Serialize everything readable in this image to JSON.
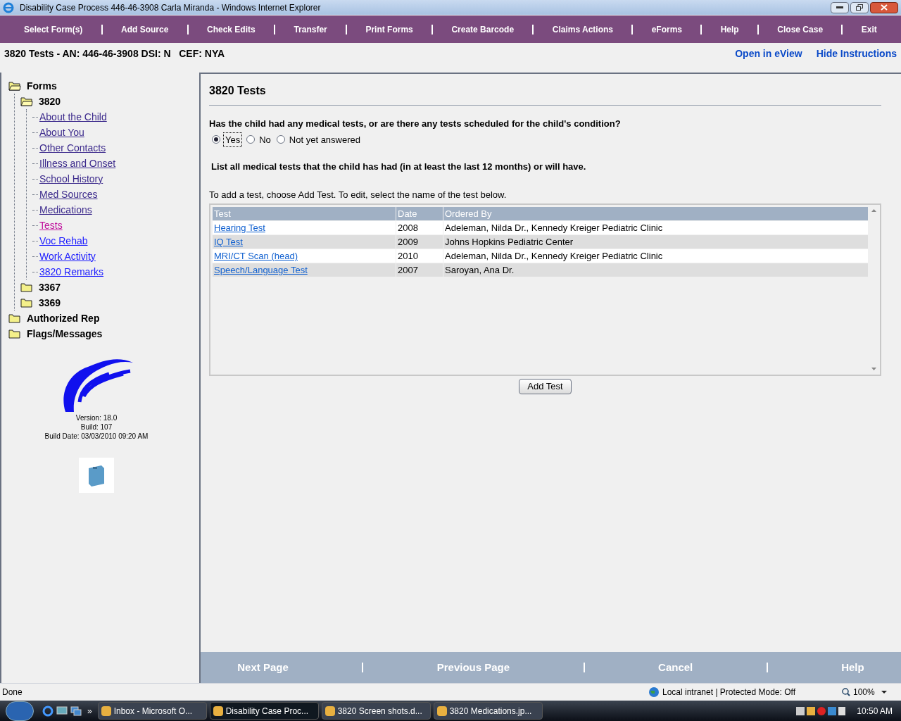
{
  "window": {
    "title": "Disability Case Process 446-46-3908 Carla Miranda - Windows Internet Explorer"
  },
  "menu": [
    "Select Form(s)",
    "Add Source",
    "Check Edits",
    "Transfer",
    "Print Forms",
    "Create Barcode",
    "Claims Actions",
    "eForms",
    "Help",
    "Close Case",
    "Exit"
  ],
  "case_info": "3820 Tests - AN: 446-46-3908 DSI: N   CEF: NYA",
  "top_links": [
    "Open in eView",
    "Hide Instructions"
  ],
  "tree": [
    {
      "label": "Forms",
      "expanded": true,
      "children": [
        {
          "label": "3820",
          "expanded": true,
          "children": [
            {
              "label": "About the Child",
              "visited": true,
              "selected": false
            },
            {
              "label": "About You",
              "visited": true,
              "selected": false
            },
            {
              "label": "Other Contacts",
              "visited": true,
              "selected": false
            },
            {
              "label": "Illness and Onset",
              "visited": true,
              "selected": false
            },
            {
              "label": "School History",
              "visited": true,
              "selected": false
            },
            {
              "label": "Med Sources",
              "visited": true,
              "selected": false
            },
            {
              "label": "Medications",
              "visited": true,
              "selected": false
            },
            {
              "label": "Tests",
              "visited": false,
              "selected": true
            },
            {
              "label": "Voc Rehab",
              "visited": false,
              "selected": false
            },
            {
              "label": "Work Activity",
              "visited": false,
              "selected": false
            },
            {
              "label": "3820 Remarks",
              "visited": false,
              "selected": false
            }
          ]
        },
        {
          "label": "3367",
          "expanded": false
        },
        {
          "label": "3369",
          "expanded": false
        }
      ]
    },
    {
      "label": "Authorized Rep",
      "expanded": false
    },
    {
      "label": "Flags/Messages",
      "expanded": false
    }
  ],
  "version_info": [
    "Version: 18.0",
    "Build: 107",
    "Build Date: 03/03/2010 09:20 AM"
  ],
  "content": {
    "title": "3820 Tests",
    "question": "Has the child had any medical tests, or are there any tests scheduled for the child's condition?",
    "options": [
      {
        "label": "Yes",
        "selected": true
      },
      {
        "label": "No",
        "selected": false
      },
      {
        "label": "Not yet answered",
        "selected": false
      }
    ],
    "instruction": "List all medical tests that the child has had (in at least the last 12 months) or will have.",
    "hint": "To add a test, choose Add Test. To edit, select the name of the test below.",
    "table": {
      "columns": [
        "Test",
        "Date",
        "Ordered By"
      ],
      "rows": [
        [
          "Hearing Test",
          "2008",
          "Adeleman, Nilda Dr., Kennedy Kreiger Pediatric Clinic"
        ],
        [
          "IQ Test",
          "2009",
          "Johns Hopkins Pediatric Center"
        ],
        [
          "MRI/CT Scan (head)",
          "2010",
          "Adeleman, Nilda Dr., Kennedy Kreiger Pediatric Clinic"
        ],
        [
          "Speech/Language Test",
          "2007",
          "Saroyan, Ana Dr."
        ]
      ]
    },
    "add_button": "Add Test"
  },
  "footer_buttons": [
    "Next Page",
    "Previous Page",
    "Cancel",
    "Help"
  ],
  "status_bar": {
    "text": "Done",
    "zone": "Local intranet | Protected Mode: Off",
    "zoom": "100%"
  },
  "taskbar": {
    "items": [
      {
        "label": "Inbox - Microsoft O...",
        "selected": false
      },
      {
        "label": "Disability Case Proc...",
        "selected": true
      },
      {
        "label": "3820 Screen shots.d...",
        "selected": false
      },
      {
        "label": "3820 Medications.jp...",
        "selected": false
      }
    ],
    "chevron": "»",
    "clock": "10:50 AM"
  }
}
